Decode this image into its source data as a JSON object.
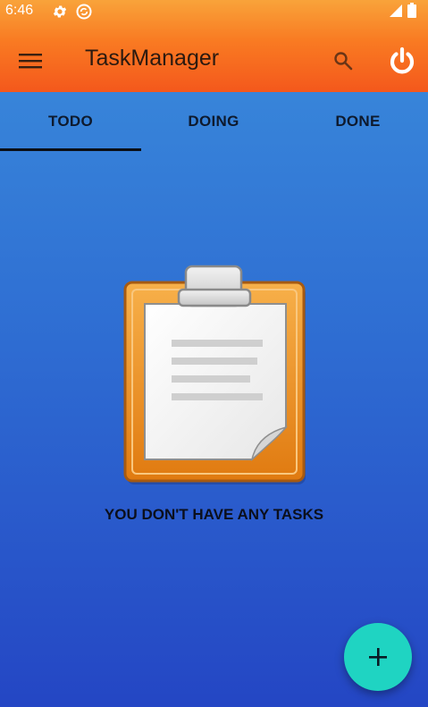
{
  "status_bar": {
    "time": "6:46",
    "icons": [
      "gear-icon",
      "sync-icon",
      "signal-icon",
      "battery-icon"
    ]
  },
  "app_bar": {
    "title": "TaskManager",
    "menu_icon": "menu-icon",
    "search_icon": "search-icon",
    "power_icon": "power-icon"
  },
  "tabs": [
    {
      "label": "TODO",
      "selected": true
    },
    {
      "label": "DOING",
      "selected": false
    },
    {
      "label": "DONE",
      "selected": false
    }
  ],
  "empty_state": {
    "illustration": "clipboard-icon",
    "message": "YOU DON'T HAVE ANY TASKS"
  },
  "fab": {
    "icon": "plus-icon"
  },
  "colors": {
    "header_top": "#f9a33a",
    "header_bottom": "#f4581c",
    "body_top": "#3b8ddc",
    "body_bottom": "#2446c4",
    "fab": "#1fd4c2",
    "tab_indicator": "#0b0f17"
  }
}
